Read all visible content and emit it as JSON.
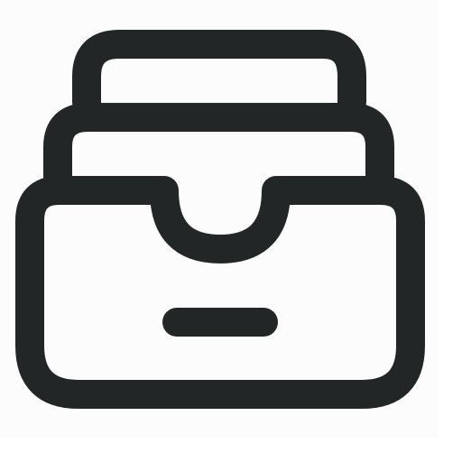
{
  "icon": {
    "name": "archive-drawer-icon",
    "stroke_color": "#222627",
    "background_color": "#fcfcfc",
    "page_background": "#ffffff"
  }
}
